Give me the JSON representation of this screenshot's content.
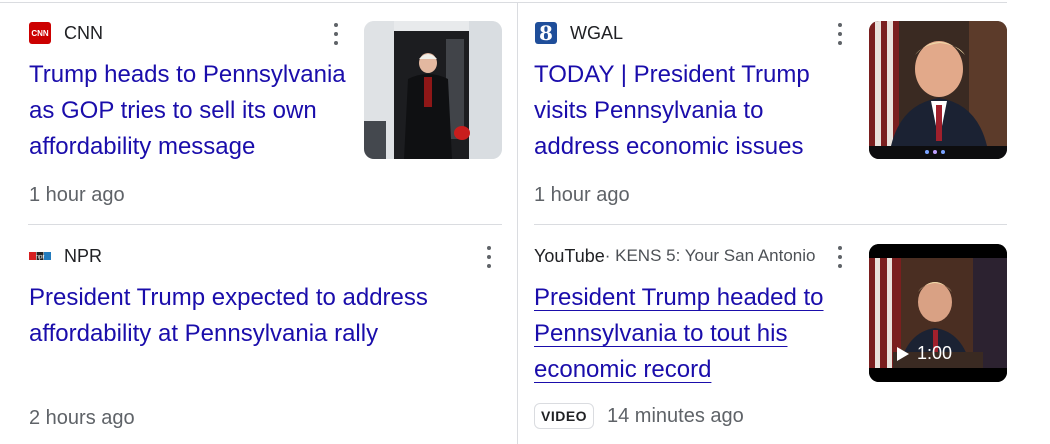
{
  "cards": [
    {
      "source": "CNN",
      "logo_icon": "cnn-logo-icon",
      "logo_text": "CNN",
      "logo_color": "#cc0000",
      "title_lines": [
        "Trump heads to Pennsylvania",
        "as GOP tries to sell its own",
        "affordability message"
      ],
      "time": "1 hour ago"
    },
    {
      "source": "WGAL",
      "logo_icon": "wgal-logo-icon",
      "logo_text": "8",
      "logo_color": "#1f4e9a",
      "title_lines": [
        "TODAY | President Trump",
        "visits Pennsylvania to",
        "address economic issues"
      ],
      "time": "1 hour ago"
    },
    {
      "source": "NPR",
      "logo_icon": "npr-logo-icon",
      "logo_text": "npr",
      "logo_color": "#1e4fa8",
      "title_lines": [
        "President Trump expected to address",
        "affordability at Pennsylvania rally"
      ],
      "time": "2 hours ago"
    },
    {
      "source": "YouTube",
      "source_sub": " · KENS 5: Your San Antonio",
      "title_lines": [
        "President Trump headed to",
        "Pennsylvania to tout his",
        "economic record"
      ],
      "badge": "VIDEO",
      "time": "14 minutes ago",
      "duration": "1:00"
    }
  ]
}
